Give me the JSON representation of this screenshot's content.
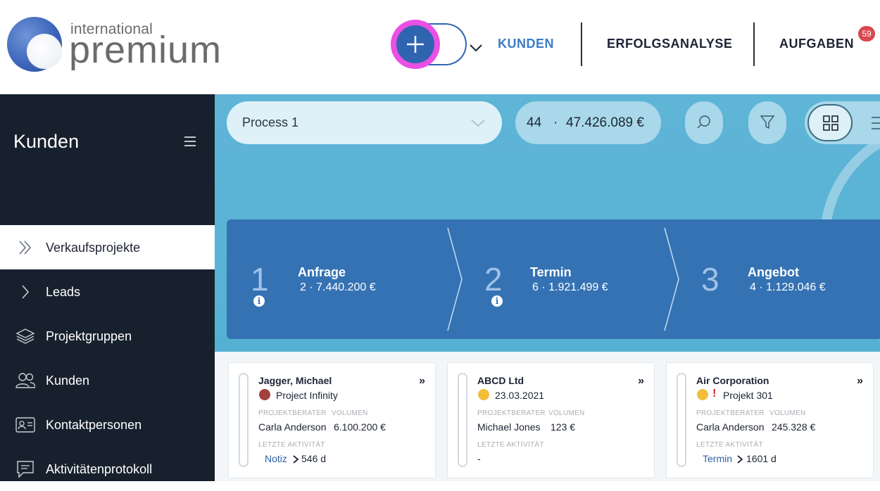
{
  "logo": {
    "small": "international",
    "big": "premium"
  },
  "nav": {
    "items": [
      {
        "label": "KUNDEN",
        "active": true
      },
      {
        "label": "ERFOLGSANALYSE",
        "active": false
      },
      {
        "label": "AUFGABEN",
        "active": false
      }
    ],
    "tasks_badge": "59"
  },
  "sidebar": {
    "title": "Kunden",
    "items": [
      {
        "label": "Verkaufsprojekte",
        "icon": "double-chevron-right-icon",
        "active": true
      },
      {
        "label": "Leads",
        "icon": "chevron-right-icon",
        "active": false
      },
      {
        "label": "Projektgruppen",
        "icon": "layers-icon",
        "active": false
      },
      {
        "label": "Kunden",
        "icon": "users-icon",
        "active": false
      },
      {
        "label": "Kontaktpersonen",
        "icon": "contact-card-icon",
        "active": false
      },
      {
        "label": "Aktivitätenprotokoll",
        "icon": "chat-log-icon",
        "active": false
      }
    ]
  },
  "toolbar": {
    "process": "Process 1",
    "count": "44",
    "separator": "·",
    "sum": "47.426.089 €"
  },
  "stages": [
    {
      "number": "1",
      "name": "Anfrage",
      "stats": "2 · 7.440.200 €"
    },
    {
      "number": "2",
      "name": "Termin",
      "stats": "6 · 1.921.499 €"
    },
    {
      "number": "3",
      "name": "Angebot",
      "stats": "4 · 1.129.046 €"
    }
  ],
  "cards": [
    {
      "name": "Jagger, Michael",
      "sub": "Project Infinity",
      "status_color": "#a2403d",
      "flag": "",
      "label_advisor": "PROJEKTBERATER",
      "label_volume": "VOLUMEN",
      "advisor": "Carla Anderson",
      "volume": "6.100.200 €",
      "label_activity": "LETZTE AKTIVITÄT",
      "activity": "Notiz",
      "days": "546 d"
    },
    {
      "name": "ABCD Ltd",
      "sub": "23.03.2021",
      "status_color": "#f2bd3b",
      "flag": "",
      "label_advisor": "PROJEKTBERATER",
      "label_volume": "VOLUMEN",
      "advisor": "Michael Jones",
      "volume": "123 €",
      "label_activity": "LETZTE AKTIVITÄT",
      "activity": "-",
      "days": ""
    },
    {
      "name": "Air Corporation",
      "sub": "Projekt 301",
      "status_color": "#f2bd3b",
      "flag": "!",
      "label_advisor": "PROJEKTBERATER",
      "label_volume": "VOLUMEN",
      "advisor": "Carla Anderson",
      "volume": "245.328 €",
      "label_activity": "LETZTE AKTIVITÄT",
      "activity": "Termin",
      "days": "1601 d"
    }
  ],
  "colors": {
    "accent": "#3b7cc7",
    "primary": "#2f64b0",
    "highlight": "#ea4fe6",
    "sidebar_bg": "#17212e",
    "stages_bg": "#3572b3",
    "badge": "#d9474f"
  }
}
